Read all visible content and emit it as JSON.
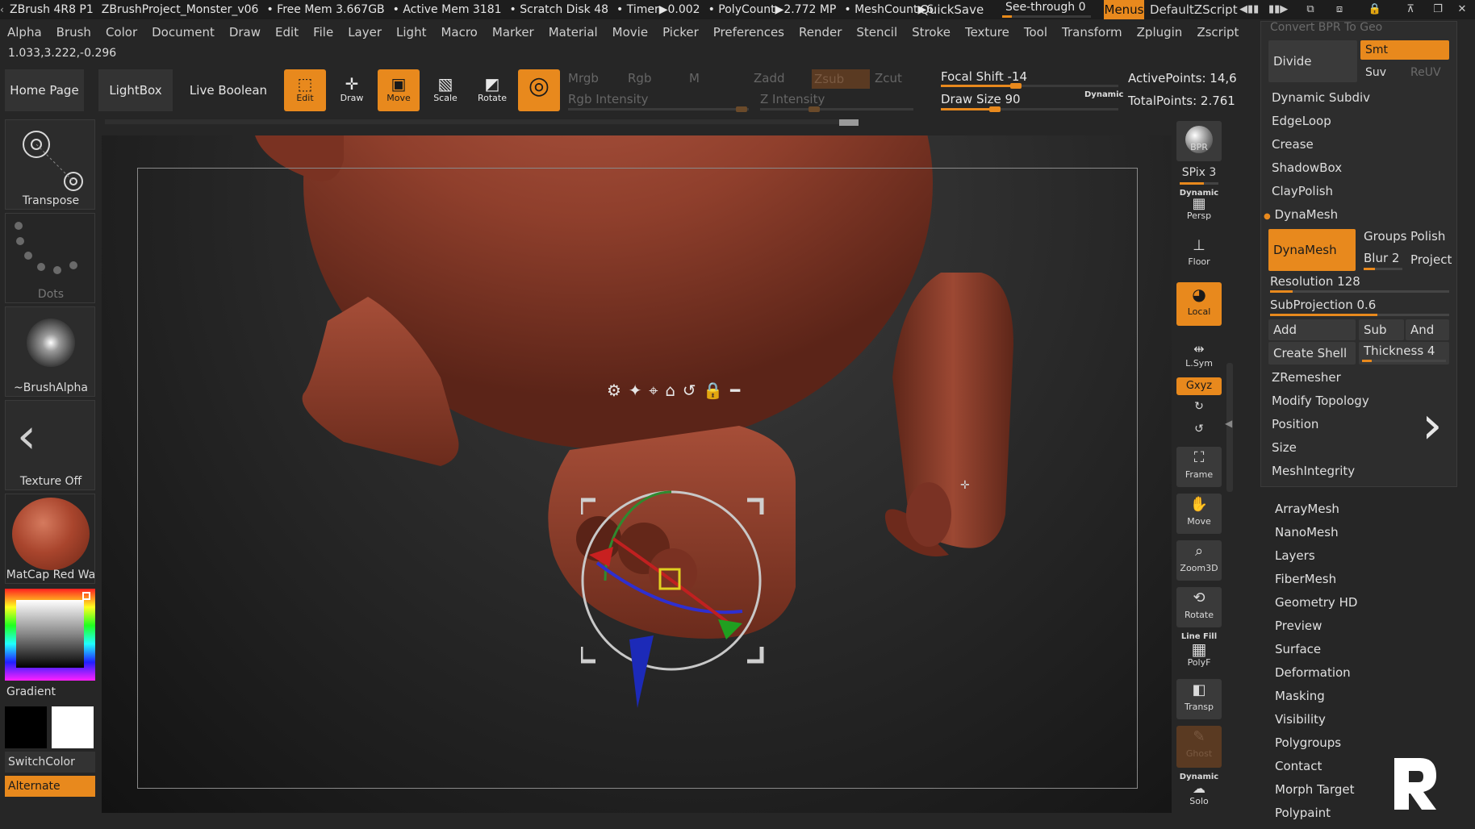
{
  "titlebar": {
    "segments": [
      "ZBrush 4R8 P1",
      "ZBrushProject_Monster_v06",
      "• Free Mem 3.667GB",
      "• Active Mem 3181",
      "• Scratch Disk 48",
      "• Timer▶0.002",
      "• PolyCount▶2.772 MP",
      "• MeshCount▶6"
    ],
    "quicksave": "QuickSave",
    "seethrough": "See-through  0",
    "menus": "Menus",
    "default_zscript": "DefaultZScript"
  },
  "menubar": [
    "Alpha",
    "Brush",
    "Color",
    "Document",
    "Draw",
    "Edit",
    "File",
    "Layer",
    "Light",
    "Macro",
    "Marker",
    "Material",
    "Movie",
    "Picker",
    "Preferences",
    "Render",
    "Stencil",
    "Stroke",
    "Texture",
    "Tool",
    "Transform",
    "Zplugin",
    "Zscript"
  ],
  "coords": "1.033,3.222,-0.296",
  "shelf": {
    "home_page": "Home Page",
    "lightbox": "LightBox",
    "live_boolean": "Live Boolean",
    "edit": "Edit",
    "draw": "Draw",
    "move": "Move",
    "scale": "Scale",
    "rotate": "Rotate",
    "mrgb": "Mrgb",
    "rgb": "Rgb",
    "m": "M",
    "rgb_intensity": "Rgb Intensity",
    "zadd": "Zadd",
    "zsub": "Zsub",
    "zcut": "Zcut",
    "z_intensity": "Z Intensity",
    "focal_shift": "Focal Shift -14",
    "draw_size": "Draw Size 90",
    "dynamic": "Dynamic",
    "active_points": "ActivePoints: 14,6",
    "total_points": "TotalPoints: 2.761"
  },
  "left_tray": {
    "transpose": "Transpose",
    "dots": "Dots",
    "brush_alpha": "~BrushAlpha",
    "texture_off": "Texture Off",
    "matcap": "MatCap Red Wa",
    "gradient": "Gradient",
    "switch_color": "SwitchColor",
    "alternate": "Alternate"
  },
  "right_shelf": {
    "bpr": "BPR",
    "spix": "SPix 3",
    "dynamic": "Dynamic",
    "persp": "Persp",
    "floor": "Floor",
    "local": "Local",
    "lsym": "L.Sym",
    "xyz": "Gxyz",
    "frame": "Frame",
    "move": "Move",
    "zoom3d": "Zoom3D",
    "rotate": "Rotate",
    "line_fill": "Line Fill",
    "polyf": "PolyF",
    "transp": "Transp",
    "ghost": "Ghost",
    "dynamic2": "Dynamic",
    "solo": "Solo"
  },
  "geometry_panel": {
    "convert_bpr": "Convert BPR To Geo",
    "divide": "Divide",
    "smt": "Smt",
    "suv": "Suv",
    "reuv": "ReUV",
    "dynamic_subdiv": "Dynamic Subdiv",
    "edgeloop": "EdgeLoop",
    "crease": "Crease",
    "shadowbox": "ShadowBox",
    "claypolish": "ClayPolish",
    "dynamesh_header": "DynaMesh",
    "dynamesh_btn": "DynaMesh",
    "groups": "Groups",
    "polish": "Polish",
    "blur": "Blur 2",
    "project": "Project",
    "resolution": "Resolution 128",
    "resolution_value": 0.128,
    "subprojection": "SubProjection 0.6",
    "subprojection_value": 0.6,
    "add": "Add",
    "sub": "Sub",
    "and": "And",
    "create_shell": "Create Shell",
    "thickness": "Thickness 4",
    "zremesher": "ZRemesher",
    "modify_topology": "Modify Topology",
    "position": "Position",
    "size": "Size",
    "meshintegrity": "MeshIntegrity"
  },
  "tool_sublist": [
    "ArrayMesh",
    "NanoMesh",
    "Layers",
    "FiberMesh",
    "Geometry HD",
    "Preview",
    "Surface",
    "Deformation",
    "Masking",
    "Visibility",
    "Polygroups",
    "Contact",
    "Morph Target",
    "Polypaint"
  ],
  "colors": {
    "accent": "#e8891d",
    "clay": "#8a3e2a",
    "background": "#262626"
  }
}
